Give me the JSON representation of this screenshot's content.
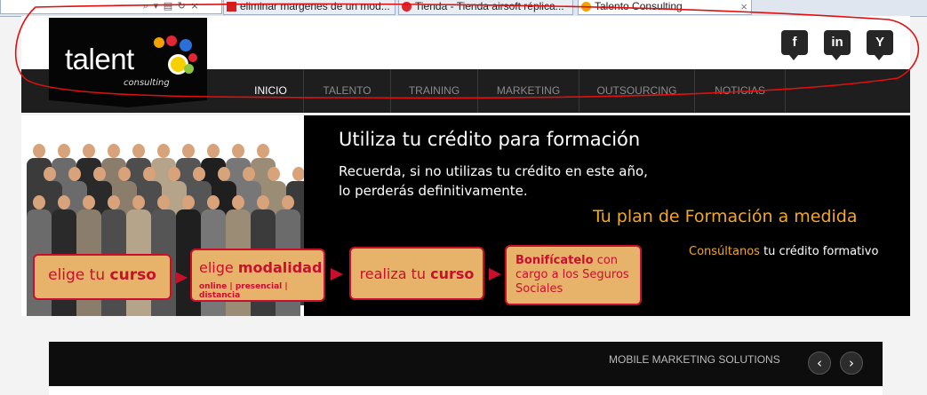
{
  "browser": {
    "tabs": [
      {
        "label": "eliminar margenes de un mod...",
        "active": false
      },
      {
        "label": "Tienda - Tienda airsoft réplica...",
        "active": false
      },
      {
        "label": "Talento Consulting",
        "active": true
      }
    ],
    "toolbar_icons": [
      "search-icon",
      "dropdown-icon",
      "compatibility-icon",
      "refresh-icon",
      "stop-icon"
    ],
    "close_glyph": "×"
  },
  "logo": {
    "word": "talent",
    "sub": "consulting",
    "dot_colors": [
      "#e32636",
      "#f5a100",
      "#2b6fd8",
      "#8cc63f",
      "#f7d000"
    ]
  },
  "social": [
    {
      "name": "facebook",
      "glyph": "f"
    },
    {
      "name": "linkedin",
      "glyph": "in"
    },
    {
      "name": "twitter",
      "glyph": "Y"
    }
  ],
  "nav": {
    "items": [
      "INICIO",
      "TALENTO",
      "TRAINING",
      "MARKETING",
      "OUTSOURCING",
      "NOTICIAS"
    ],
    "active_index": 0
  },
  "banner": {
    "title": "Utiliza tu crédito para formación",
    "line1": "Recuerda, si no utilizas tu crédito en este año,",
    "line2": "lo perderás definitivamente.",
    "plan": "Tu plan de Formación a medida",
    "consult_highlight": "Consúltanos",
    "consult_rest": " tu crédito formativo",
    "steps": [
      {
        "pre": "elige tu ",
        "bold": "curso",
        "sub": ""
      },
      {
        "pre": "elige ",
        "bold": "modalidad",
        "sub": "online | presencial | distancia"
      },
      {
        "pre": "realiza tu ",
        "bold": "curso",
        "sub": ""
      },
      {
        "pre": "",
        "bold": "Bonifícatelo",
        "rest": " con cargo a los Seguros Sociales",
        "sub": ""
      }
    ],
    "colors": {
      "accent": "#f2a91c",
      "step_fill": "#e7b36b",
      "step_border": "#c8102e"
    }
  },
  "section": {
    "title": "MOBILE MARKETING SOLUTIONS",
    "prev": "‹",
    "next": "›"
  },
  "annotation_color": "#e01010"
}
